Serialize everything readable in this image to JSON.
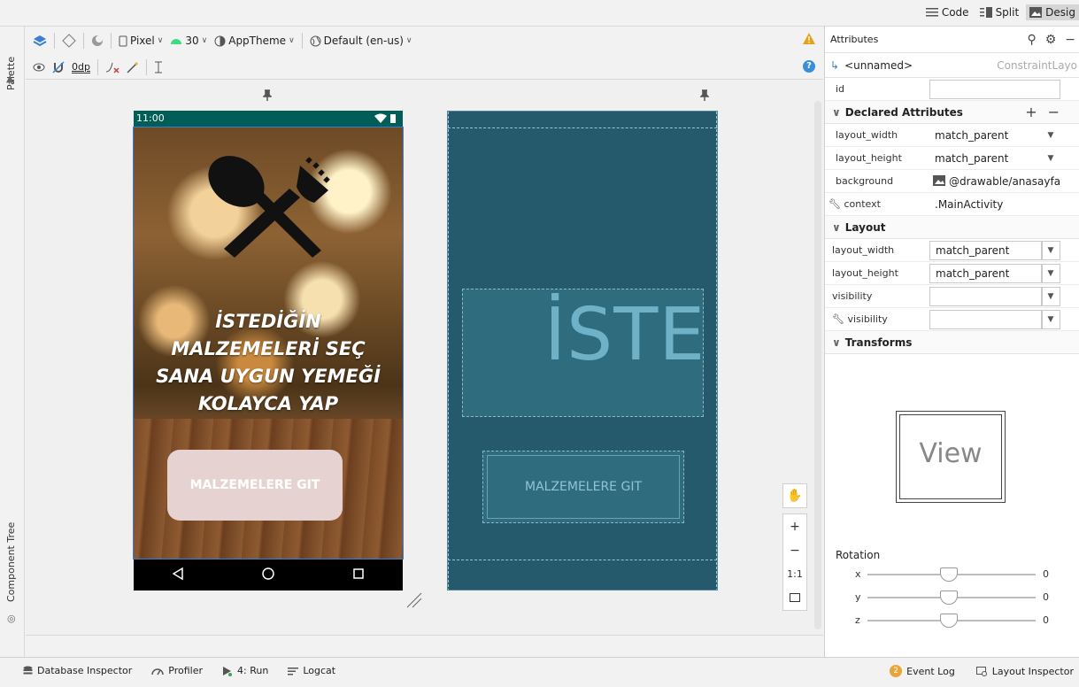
{
  "view_modes": [
    {
      "label": "Code",
      "icon": "code-lines-icon"
    },
    {
      "label": "Split",
      "icon": "split-view-icon"
    },
    {
      "label": "Desig",
      "icon": "design-view-icon"
    }
  ],
  "side_labels": {
    "palette": "Palette",
    "component_tree": "Component Tree"
  },
  "toolbar": {
    "device": "Pixel",
    "api": "30",
    "theme": "AppTheme",
    "locale": "Default (en-us)",
    "margin": "0dp"
  },
  "phone": {
    "time": "11:00",
    "headline": [
      "İSTEDİĞİN",
      "MALZEMELERİ SEÇ",
      "SANA UYGUN YEMEĞİ",
      "KOLAYCA YAP"
    ],
    "button": "MALZEMELERE GIT"
  },
  "blueprint": {
    "text_preview": "İSTE",
    "button": "MALZEMELERE GIT"
  },
  "zoom": {
    "fit_label": "1:1"
  },
  "attributes": {
    "title": "Attributes",
    "component_name": "<unnamed>",
    "component_class": "ConstraintLayo",
    "id_label": "id",
    "id_value": "",
    "declared_title": "Declared Attributes",
    "declared": [
      {
        "key": "layout_width",
        "value": "match_parent"
      },
      {
        "key": "layout_height",
        "value": "match_parent"
      },
      {
        "key": "background",
        "value": "@drawable/anasayfa"
      },
      {
        "key": "context",
        "value": ".MainActivity"
      }
    ],
    "layout_title": "Layout",
    "layout": [
      {
        "key": "layout_width",
        "value": "match_parent"
      },
      {
        "key": "layout_height",
        "value": "match_parent"
      },
      {
        "key": "visibility",
        "value": ""
      },
      {
        "key": "visibility",
        "value": ""
      }
    ],
    "transforms_title": "Transforms",
    "view_preview": "View",
    "rotation_label": "Rotation",
    "rotation": [
      {
        "axis": "x",
        "value": "0"
      },
      {
        "axis": "y",
        "value": "0"
      },
      {
        "axis": "z",
        "value": "0"
      }
    ]
  },
  "bottom_tools": [
    "Database Inspector",
    "Profiler",
    "4: Run",
    "Logcat"
  ],
  "bottom_right": {
    "event_log": "Event Log",
    "event_count": "2",
    "layout_inspector": "Layout Inspector"
  },
  "colors": {
    "status_bar": "#015e57",
    "blueprint": "#245a6b",
    "cta": "#e6d3d1",
    "accent": "#3d7ad0"
  }
}
